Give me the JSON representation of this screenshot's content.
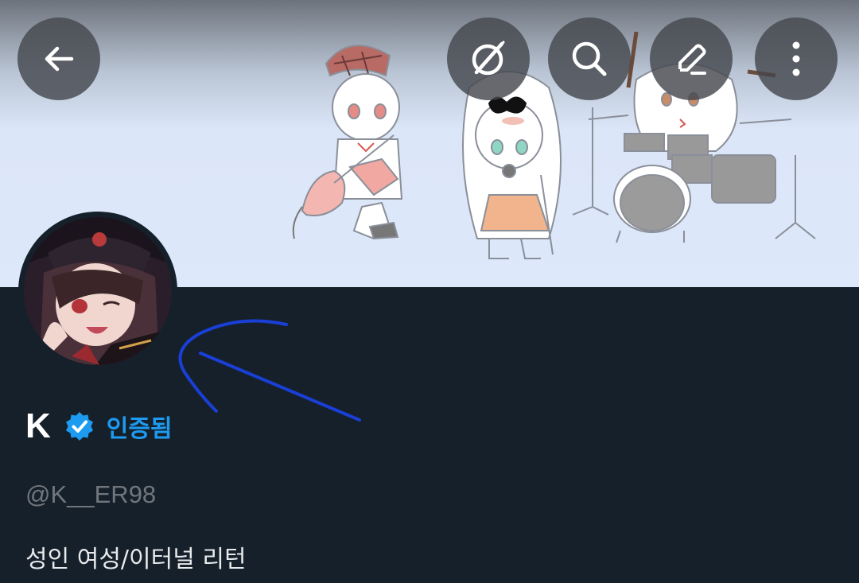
{
  "header": {
    "back_icon": "arrow-left-icon",
    "actions": [
      {
        "icon": "grok-icon"
      },
      {
        "icon": "search-icon"
      },
      {
        "icon": "edit-icon"
      },
      {
        "icon": "more-vertical-icon"
      }
    ]
  },
  "profile": {
    "display_name": "K",
    "verified_badge_icon": "verified-badge-icon",
    "verified_label": "인증됨",
    "handle": "@K__ER98",
    "bio": "성인 여성/이터널 리턴"
  },
  "colors": {
    "background": "#15202b",
    "accent": "#1d9bf0",
    "secondary_text": "#71767b",
    "annotation": "#1a3fd6"
  }
}
